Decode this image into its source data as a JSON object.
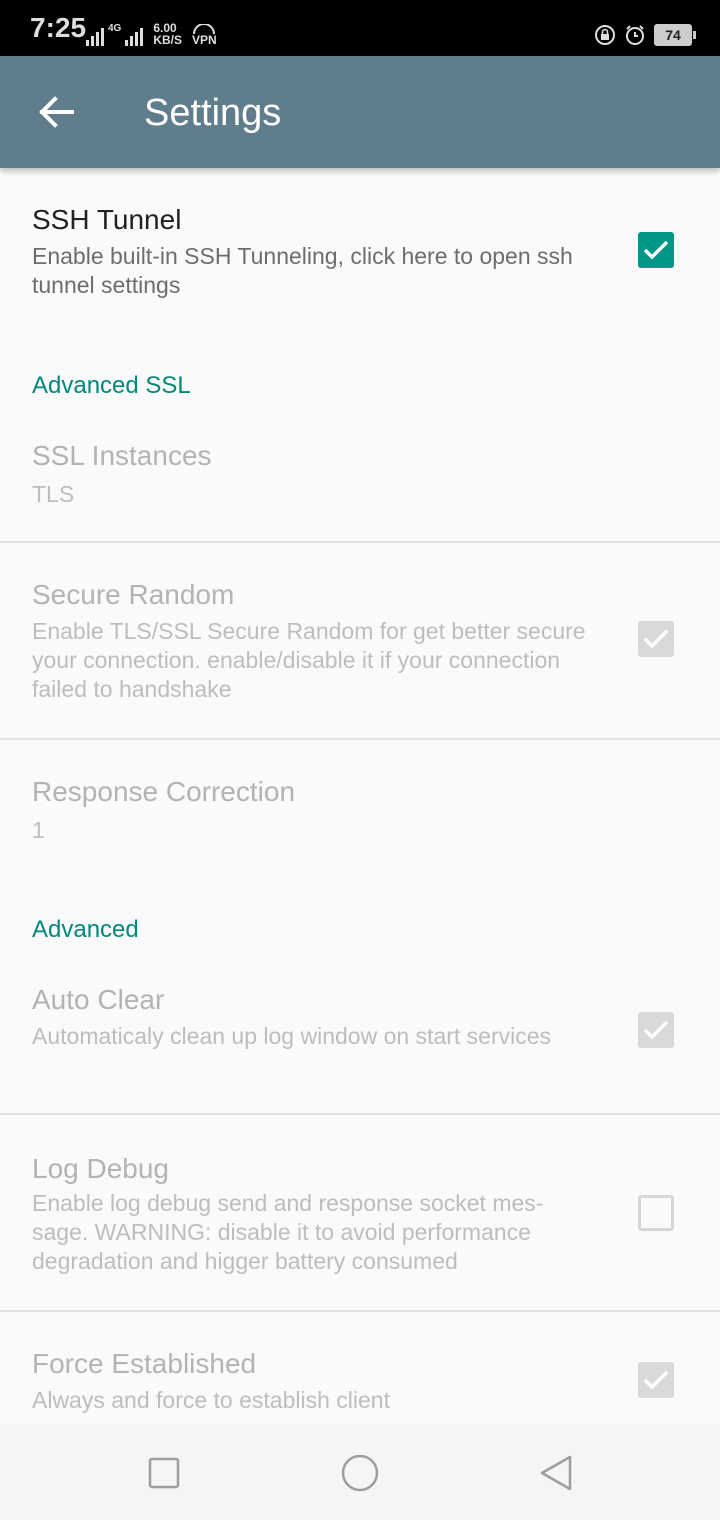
{
  "status_bar": {
    "time": "7:25",
    "network_tag": "4G",
    "speed_value": "6.00",
    "speed_unit": "KB/S",
    "vpn": "VPN",
    "battery": "74"
  },
  "app_bar": {
    "title": "Settings",
    "icon": "arrow-back-icon"
  },
  "colors": {
    "app_bar": "#607d8b",
    "accent": "#009688",
    "category": "#00897b"
  },
  "prefs": {
    "ssh_tunnel": {
      "title": "SSH Tunnel",
      "summary": "Enable built-in SSH Tunneling, click here to open ssh tunnel settings",
      "checked": true
    },
    "advanced_ssl": {
      "label": "Advanced SSL"
    },
    "ssl_instances": {
      "title": "SSL Instances",
      "value": "TLS"
    },
    "secure_random": {
      "title": "Secure Random",
      "summary": "Enable TLS/SSL Secure Random for get better secure your connection. enable/disable it if your connection failed to handshake",
      "checked": true
    },
    "response_correction": {
      "title": "Response Correction",
      "value": "1"
    },
    "advanced": {
      "label": "Advanced"
    },
    "auto_clear": {
      "title": "Auto Clear",
      "summary": "Automaticaly clean up log window on start services",
      "checked": true
    },
    "log_debug": {
      "title": "Log Debug",
      "summary": "Enable log debug send and response socket mes-sage. WARNING: disable it to avoid performance degradation and higger battery consumed",
      "checked": false
    },
    "force_established": {
      "title": "Force Established",
      "summary": "Always and force to establish client",
      "checked": true
    }
  },
  "nav_bar": {
    "recents_icon": "square-icon",
    "home_icon": "circle-icon",
    "back_icon": "triangle-back-icon"
  }
}
